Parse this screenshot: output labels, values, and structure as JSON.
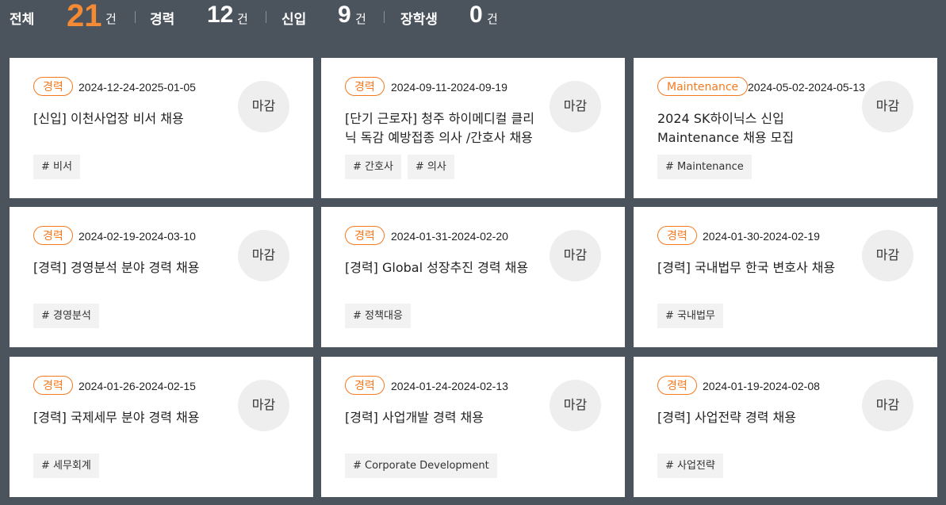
{
  "summary": {
    "all": {
      "label": "전체",
      "count": "21",
      "unit": "건"
    },
    "experienced": {
      "label": "경력",
      "count": "12",
      "unit": "건"
    },
    "newcomer": {
      "label": "신입",
      "count": "9",
      "unit": "건"
    },
    "scholarship": {
      "label": "장학생",
      "count": "0",
      "unit": "건"
    }
  },
  "colors": {
    "accent": "#f5791f",
    "background": "#4b535d",
    "card": "#ffffff"
  },
  "jobs": [
    {
      "badge": "경력",
      "period": "2024-12-24-2025-01-05",
      "title": "[신입] 이천사업장 비서 채용",
      "tags": [
        "# 비서"
      ],
      "status": "마감"
    },
    {
      "badge": "경력",
      "period": "2024-09-11-2024-09-19",
      "title": "[단기 근로자] 청주 하이메디컬 클리닉 독감 예방접종 의사 /간호사 채용",
      "tags": [
        "# 간호사",
        "# 의사"
      ],
      "status": "마감"
    },
    {
      "badge": "Maintenance",
      "period": "2024-05-02-2024-05-13",
      "title": "2024 SK하이닉스 신입 Maintenance 채용 모집",
      "tags": [
        "# Maintenance"
      ],
      "status": "마감"
    },
    {
      "badge": "경력",
      "period": "2024-02-19-2024-03-10",
      "title": "[경력] 경영분석 분야 경력 채용",
      "tags": [
        "# 경영분석"
      ],
      "status": "마감"
    },
    {
      "badge": "경력",
      "period": "2024-01-31-2024-02-20",
      "title": "[경력] Global 성장추진 경력 채용",
      "tags": [
        "# 정책대응"
      ],
      "status": "마감"
    },
    {
      "badge": "경력",
      "period": "2024-01-30-2024-02-19",
      "title": "[경력] 국내법무 한국 변호사 채용",
      "tags": [
        "# 국내법무"
      ],
      "status": "마감"
    },
    {
      "badge": "경력",
      "period": "2024-01-26-2024-02-15",
      "title": "[경력] 국제세무 분야 경력 채용",
      "tags": [
        "# 세무회계"
      ],
      "status": "마감"
    },
    {
      "badge": "경력",
      "period": "2024-01-24-2024-02-13",
      "title": "[경력] 사업개발 경력 채용",
      "tags": [
        "# Corporate Development"
      ],
      "status": "마감"
    },
    {
      "badge": "경력",
      "period": "2024-01-19-2024-02-08",
      "title": "[경력] 사업전략 경력 채용",
      "tags": [
        "# 사업전략"
      ],
      "status": "마감"
    }
  ]
}
